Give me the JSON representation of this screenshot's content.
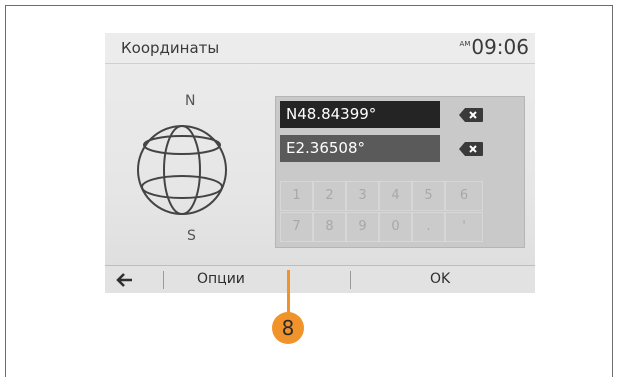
{
  "header": {
    "title": "Координаты",
    "ampm": "AM",
    "time": "09:06"
  },
  "compass": {
    "north": "N",
    "south": "S"
  },
  "fields": {
    "latitude": "N48.84399°",
    "longitude": "E2.36508°"
  },
  "keypad": {
    "row1": [
      "1",
      "2",
      "3",
      "4",
      "5",
      "6"
    ],
    "row2": [
      "7",
      "8",
      "9",
      "0",
      ".",
      "'"
    ]
  },
  "bottom_bar": {
    "options_label": "Опции",
    "ok_label": "OK"
  },
  "callout": {
    "number": "8"
  },
  "colors": {
    "callout": "#f0932b",
    "active_field": "#242424",
    "inactive_field": "#5a5a5a"
  }
}
